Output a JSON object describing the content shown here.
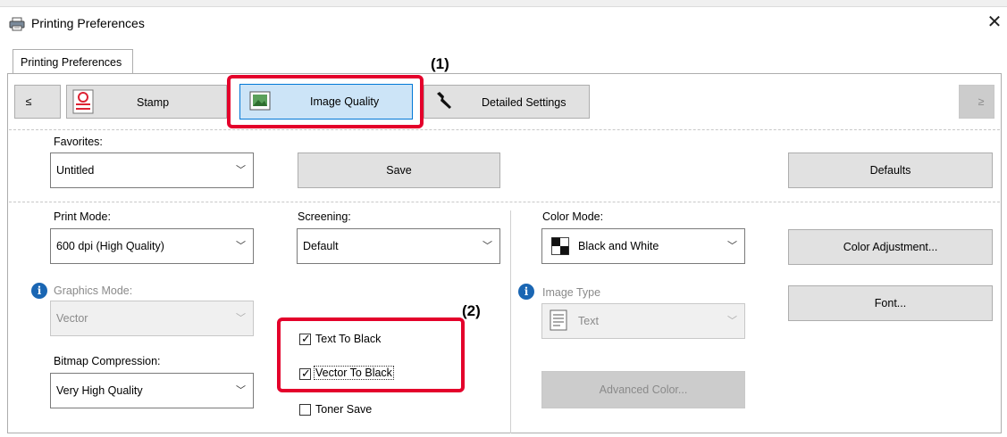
{
  "window": {
    "title": "Printing Preferences",
    "close_glyph": "✕",
    "outer_tab": "Printing Preferences"
  },
  "tabs": {
    "prev_glyph": "≤",
    "next_glyph": "≥",
    "items": [
      {
        "label": "Stamp",
        "icon": "stamp-icon"
      },
      {
        "label": "Image Quality",
        "icon": "image-quality-icon"
      },
      {
        "label": "Detailed Settings",
        "icon": "wrench-icon"
      }
    ]
  },
  "favorites": {
    "label": "Favorites:",
    "value": "Untitled",
    "save_label": "Save",
    "defaults_label": "Defaults"
  },
  "print_mode": {
    "label": "Print Mode:",
    "value": "600 dpi (High Quality)"
  },
  "screening": {
    "label": "Screening:",
    "value": "Default"
  },
  "color_mode": {
    "label": "Color Mode:",
    "value": "Black and White"
  },
  "color_adjustment_label": "Color Adjustment...",
  "graphics_mode": {
    "label": "Graphics Mode:",
    "value": "Vector"
  },
  "image_type": {
    "label": "Image Type",
    "value": "Text"
  },
  "font_label": "Font...",
  "bitmap_compression": {
    "label": "Bitmap Compression:",
    "value": "Very High Quality"
  },
  "checkboxes": {
    "text_to_black": {
      "label": "Text To Black",
      "checked": true
    },
    "vector_to_black": {
      "label": "Vector To Black",
      "checked": true
    },
    "toner_save": {
      "label": "Toner Save",
      "checked": false
    }
  },
  "advanced_color_label": "Advanced Color...",
  "annotations": {
    "callout1": "(1)",
    "callout2": "(2)",
    "highlight_color": "#e4002b"
  },
  "colors": {
    "info_blue": "#1a66b3",
    "selected_tab": "#cce4f7"
  }
}
